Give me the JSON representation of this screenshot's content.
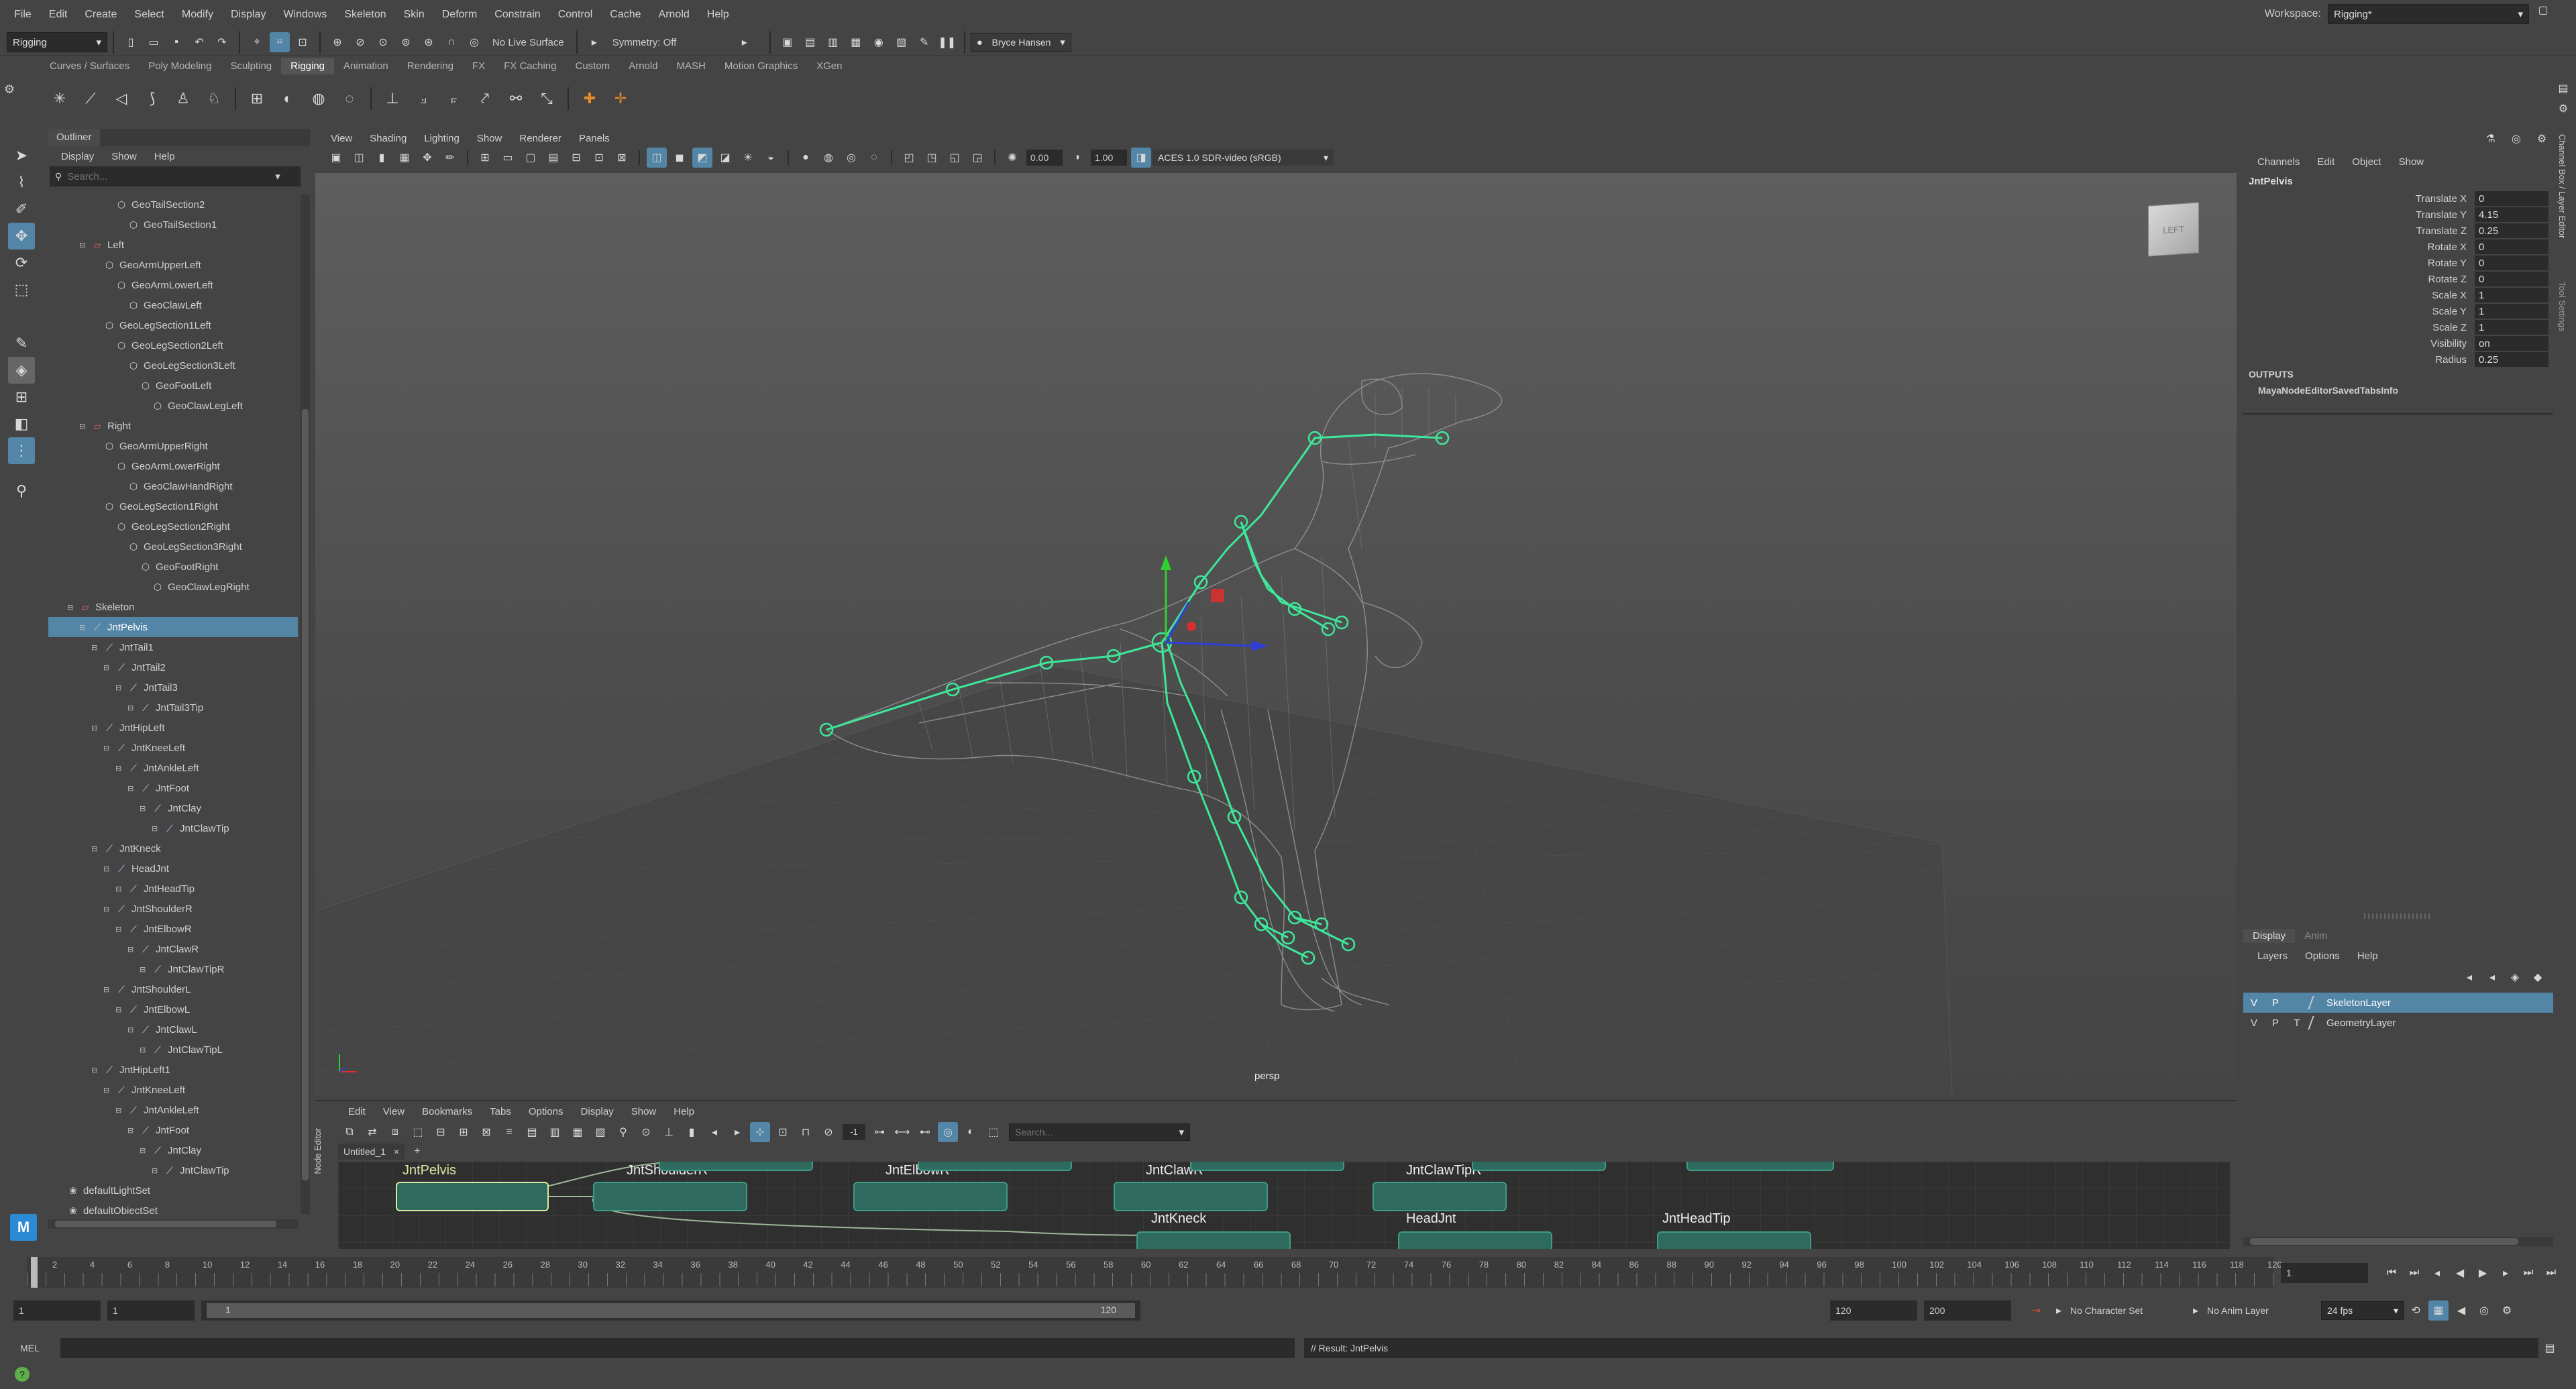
{
  "menu": [
    "File",
    "Edit",
    "Create",
    "Select",
    "Modify",
    "Display",
    "Windows",
    "Skeleton",
    "Skin",
    "Deform",
    "Constrain",
    "Control",
    "Cache",
    "Arnold",
    "Help"
  ],
  "workspace": {
    "label": "Workspace:",
    "value": "Rigging*"
  },
  "statusline": {
    "mode": "Rigging",
    "live_surface": "No Live Surface",
    "symmetry": "Symmetry: Off",
    "user": "Bryce Hansen"
  },
  "shelf_tabs": [
    "Curves / Surfaces",
    "Poly Modeling",
    "Sculpting",
    "Rigging",
    "Animation",
    "Rendering",
    "FX",
    "FX Caching",
    "Custom",
    "Arnold",
    "MASH",
    "Motion Graphics",
    "XGen"
  ],
  "shelf_active": "Rigging",
  "outliner": {
    "title": "Outliner",
    "menu": [
      "Display",
      "Show",
      "Help"
    ],
    "search_placeholder": "Search...",
    "items": [
      {
        "label": "GeoTailSection2",
        "depth": 4,
        "type": "mesh"
      },
      {
        "label": "GeoTailSection1",
        "depth": 5,
        "type": "mesh"
      },
      {
        "label": "Left",
        "depth": 2,
        "type": "group"
      },
      {
        "label": "GeoArmUpperLeft",
        "depth": 3,
        "type": "mesh"
      },
      {
        "label": "GeoArmLowerLeft",
        "depth": 4,
        "type": "mesh"
      },
      {
        "label": "GeoClawLeft",
        "depth": 5,
        "type": "mesh"
      },
      {
        "label": "GeoLegSection1Left",
        "depth": 3,
        "type": "mesh"
      },
      {
        "label": "GeoLegSection2Left",
        "depth": 4,
        "type": "mesh"
      },
      {
        "label": "GeoLegSection3Left",
        "depth": 5,
        "type": "mesh"
      },
      {
        "label": "GeoFootLeft",
        "depth": 6,
        "type": "mesh"
      },
      {
        "label": "GeoClawLegLeft",
        "depth": 7,
        "type": "mesh"
      },
      {
        "label": "Right",
        "depth": 2,
        "type": "group"
      },
      {
        "label": "GeoArmUpperRight",
        "depth": 3,
        "type": "mesh"
      },
      {
        "label": "GeoArmLowerRight",
        "depth": 4,
        "type": "mesh"
      },
      {
        "label": "GeoClawHandRight",
        "depth": 5,
        "type": "mesh"
      },
      {
        "label": "GeoLegSection1Right",
        "depth": 3,
        "type": "mesh"
      },
      {
        "label": "GeoLegSection2Right",
        "depth": 4,
        "type": "mesh"
      },
      {
        "label": "GeoLegSection3Right",
        "depth": 5,
        "type": "mesh"
      },
      {
        "label": "GeoFootRight",
        "depth": 6,
        "type": "mesh"
      },
      {
        "label": "GeoClawLegRight",
        "depth": 7,
        "type": "mesh"
      },
      {
        "label": "Skeleton",
        "depth": 1,
        "type": "group"
      },
      {
        "label": "JntPelvis",
        "depth": 2,
        "type": "joint",
        "selected": true
      },
      {
        "label": "JntTail1",
        "depth": 3,
        "type": "joint"
      },
      {
        "label": "JntTail2",
        "depth": 4,
        "type": "joint"
      },
      {
        "label": "JntTail3",
        "depth": 5,
        "type": "joint"
      },
      {
        "label": "JntTail3Tip",
        "depth": 6,
        "type": "joint"
      },
      {
        "label": "JntHipLeft",
        "depth": 3,
        "type": "joint"
      },
      {
        "label": "JntKneeLeft",
        "depth": 4,
        "type": "joint"
      },
      {
        "label": "JntAnkleLeft",
        "depth": 5,
        "type": "joint"
      },
      {
        "label": "JntFoot",
        "depth": 6,
        "type": "joint"
      },
      {
        "label": "JntClay",
        "depth": 7,
        "type": "joint"
      },
      {
        "label": "JntClawTip",
        "depth": 8,
        "type": "joint"
      },
      {
        "label": "JntKneck",
        "depth": 3,
        "type": "joint"
      },
      {
        "label": "HeadJnt",
        "depth": 4,
        "type": "joint"
      },
      {
        "label": "JntHeadTip",
        "depth": 5,
        "type": "joint"
      },
      {
        "label": "JntShoulderR",
        "depth": 4,
        "type": "joint"
      },
      {
        "label": "JntElbowR",
        "depth": 5,
        "type": "joint"
      },
      {
        "label": "JntClawR",
        "depth": 6,
        "type": "joint"
      },
      {
        "label": "JntClawTipR",
        "depth": 7,
        "type": "joint"
      },
      {
        "label": "JntShoulderL",
        "depth": 4,
        "type": "joint"
      },
      {
        "label": "JntElbowL",
        "depth": 5,
        "type": "joint"
      },
      {
        "label": "JntClawL",
        "depth": 6,
        "type": "joint"
      },
      {
        "label": "JntClawTipL",
        "depth": 7,
        "type": "joint"
      },
      {
        "label": "JntHipLeft1",
        "depth": 3,
        "type": "joint"
      },
      {
        "label": "JntKneeLeft",
        "depth": 4,
        "type": "joint"
      },
      {
        "label": "JntAnkleLeft",
        "depth": 5,
        "type": "joint"
      },
      {
        "label": "JntFoot",
        "depth": 6,
        "type": "joint"
      },
      {
        "label": "JntClay",
        "depth": 7,
        "type": "joint"
      },
      {
        "label": "JntClawTip",
        "depth": 8,
        "type": "joint"
      },
      {
        "label": "defaultLightSet",
        "depth": 0,
        "type": "set"
      },
      {
        "label": "defaultObjectSet",
        "depth": 0,
        "type": "set"
      }
    ]
  },
  "viewport": {
    "menu": [
      "View",
      "Shading",
      "Lighting",
      "Show",
      "Renderer",
      "Panels"
    ],
    "exposure": "0.00",
    "gamma": "1.00",
    "colorspace": "ACES 1.0 SDR-video (sRGB)",
    "camera_label": "persp",
    "viewcube": "LEFT"
  },
  "node_editor": {
    "side_title": "Node Editor",
    "menu": [
      "Edit",
      "View",
      "Bookmarks",
      "Tabs",
      "Options",
      "Display",
      "Show",
      "Help"
    ],
    "tab": "Untitled_1",
    "search_placeholder": "Search...",
    "field_value": "-1",
    "nodes": [
      "JntPelvis",
      "JntShoulderR",
      "JntElbowR",
      "JntClawR",
      "JntClawTipR",
      "JntKneck",
      "HeadJnt",
      "JntHeadTip"
    ]
  },
  "channel_box": {
    "menu": [
      "Channels",
      "Edit",
      "Object",
      "Show"
    ],
    "object": "JntPelvis",
    "attrs": [
      {
        "name": "Translate X",
        "value": "0"
      },
      {
        "name": "Translate Y",
        "value": "4.15"
      },
      {
        "name": "Translate Z",
        "value": "0.25"
      },
      {
        "name": "Rotate X",
        "value": "0"
      },
      {
        "name": "Rotate Y",
        "value": "0"
      },
      {
        "name": "Rotate Z",
        "value": "0"
      },
      {
        "name": "Scale X",
        "value": "1"
      },
      {
        "name": "Scale Y",
        "value": "1"
      },
      {
        "name": "Scale Z",
        "value": "1"
      },
      {
        "name": "Visibility",
        "value": "on"
      },
      {
        "name": "Radius",
        "value": "0.25"
      }
    ],
    "outputs_label": "OUTPUTS",
    "outputs_item": "MayaNodeEditorSavedTabsInfo",
    "side_tabs": "Channel Box / Layer Editor",
    "side_tabs2": "Tool Settings"
  },
  "layer_editor": {
    "tabs": [
      "Display",
      "Anim"
    ],
    "menu": [
      "Layers",
      "Options",
      "Help"
    ],
    "layers": [
      {
        "v": "V",
        "p": "P",
        "t": "",
        "name": "SkeletonLayer",
        "selected": true
      },
      {
        "v": "V",
        "p": "P",
        "t": "T",
        "name": "GeometryLayer",
        "selected": false
      }
    ]
  },
  "timeline": {
    "ticks": [
      "1",
      "2",
      "4",
      "6",
      "8",
      "10",
      "12",
      "14",
      "16",
      "18",
      "20",
      "22",
      "24",
      "26",
      "28",
      "30",
      "32",
      "34",
      "36",
      "38",
      "40",
      "42",
      "44",
      "46",
      "48",
      "50",
      "52",
      "54",
      "56",
      "58",
      "60",
      "62",
      "64",
      "66",
      "68",
      "70",
      "72",
      "74",
      "76",
      "78",
      "80",
      "82",
      "84",
      "86",
      "88",
      "90",
      "92",
      "94",
      "96",
      "98",
      "100",
      "102",
      "104",
      "106",
      "108",
      "110",
      "112",
      "114",
      "116",
      "118",
      "120"
    ],
    "current_frame": "1"
  },
  "range": {
    "start": "1",
    "start2": "1",
    "slider_start": "1",
    "slider_end": "120",
    "end": "120",
    "end2": "200",
    "character_set": "No Character Set",
    "anim_layer": "No Anim Layer",
    "fps": "24 fps"
  },
  "command": {
    "lang": "MEL",
    "result": "// Result: JntPelvis"
  }
}
